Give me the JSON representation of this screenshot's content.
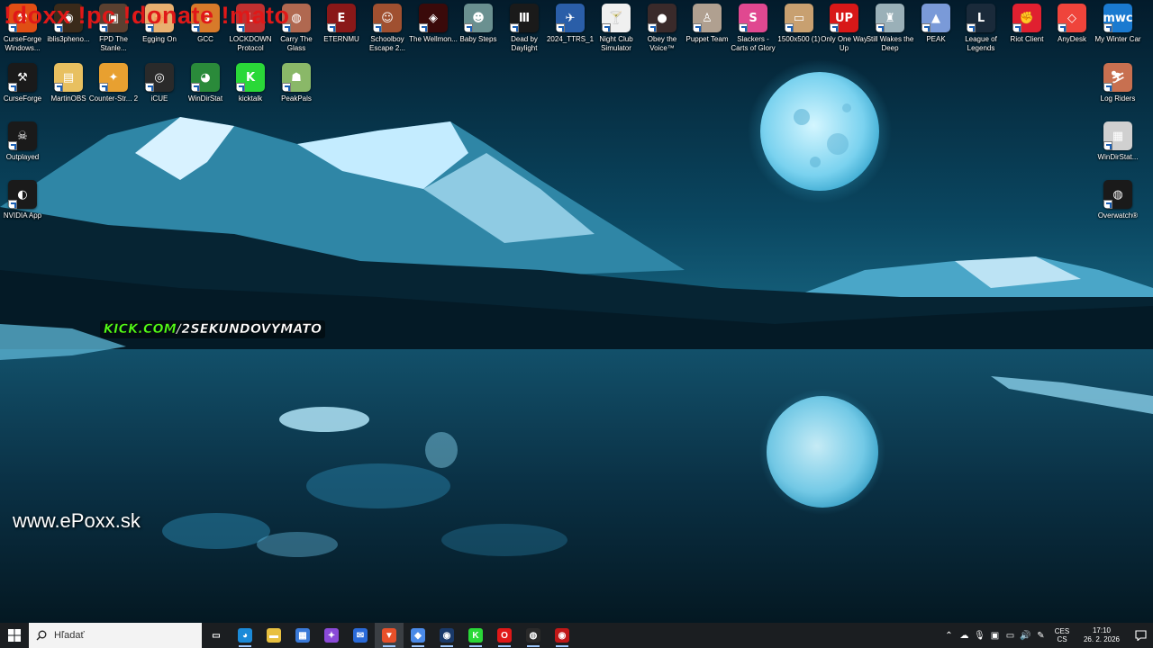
{
  "overlay": {
    "commands": "!doxx !pc !donate !mato",
    "kick_prefix": "KICK.COM",
    "kick_suffix": "/2SEKUNDOVYMATO",
    "site_url": "www.ePoxx.sk"
  },
  "desktop_icons": [
    {
      "name": "curseforge-windows",
      "label": "CurseForge Windows...",
      "color": "#e04e14",
      "glyph": "⚒"
    },
    {
      "name": "iblis3pheno",
      "label": "iblis3pheno...",
      "color": "#3a2a1a",
      "glyph": "◉"
    },
    {
      "name": "fpd-the-stanley",
      "label": "FPD The Stanle...",
      "color": "#5a4030",
      "glyph": "▣"
    },
    {
      "name": "egging-on",
      "label": "Egging On",
      "color": "#e8b070",
      "glyph": "🥚"
    },
    {
      "name": "gcc",
      "label": "GCC",
      "color": "#d87a2a",
      "glyph": "G"
    },
    {
      "name": "lockdown-protocol",
      "label": "LOCKDOWN Protocol",
      "color": "#c03030",
      "glyph": "L"
    },
    {
      "name": "carry-the-glass",
      "label": "Carry The Glass",
      "color": "#b06850",
      "glyph": "◍"
    },
    {
      "name": "eternmu",
      "label": "ETERNMU",
      "color": "#8a1818",
      "glyph": "E"
    },
    {
      "name": "schoolboy-escape",
      "label": "Schoolboy Escape 2...",
      "color": "#a05030",
      "glyph": "☺"
    },
    {
      "name": "the-wellmonster",
      "label": "The Wellmon...",
      "color": "#3a0a0a",
      "glyph": "◈"
    },
    {
      "name": "baby-steps",
      "label": "Baby Steps",
      "color": "#6a9090",
      "glyph": "☻"
    },
    {
      "name": "dead-by-daylight",
      "label": "Dead by Daylight",
      "color": "#1a1a1a",
      "glyph": "Ⅲ"
    },
    {
      "name": "2024-ttrs",
      "label": "2024_TTRS_1",
      "color": "#2a5ea8",
      "glyph": "✈"
    },
    {
      "name": "night-club-simulator",
      "label": "Night Club Simulator",
      "color": "#f0f0f0",
      "glyph": "🍸"
    },
    {
      "name": "obey-the-voice",
      "label": "Obey the Voice™",
      "color": "#3a2a2a",
      "glyph": "●"
    },
    {
      "name": "puppet-team",
      "label": "Puppet Team",
      "color": "#b0a090",
      "glyph": "♙"
    },
    {
      "name": "slackers-carts-of-glory",
      "label": "Slackers - Carts of Glory",
      "color": "#e04890",
      "glyph": "S"
    },
    {
      "name": "image-1500x500",
      "label": "1500x500 (1)",
      "color": "#c8a070",
      "glyph": "▭"
    },
    {
      "name": "only-one-way-up",
      "label": "Only One Way Up",
      "color": "#d81818",
      "glyph": "UP"
    },
    {
      "name": "still-wakes-the-deep",
      "label": "Still Wakes the Deep",
      "color": "#9ab0b8",
      "glyph": "♜"
    },
    {
      "name": "peak",
      "label": "PEAK",
      "color": "#7a9ad8",
      "glyph": "▲"
    },
    {
      "name": "league-of-legends",
      "label": "League of Legends",
      "color": "#1a2a3a",
      "glyph": "L"
    },
    {
      "name": "riot-client",
      "label": "Riot Client",
      "color": "#e02030",
      "glyph": "✊"
    },
    {
      "name": "anydesk",
      "label": "AnyDesk",
      "color": "#ef443b",
      "glyph": "◇"
    },
    {
      "name": "my-winter-car",
      "label": "My Winter Car",
      "color": "#1a7ad0",
      "glyph": "mwc"
    },
    {
      "name": "curseforge",
      "label": "CurseForge",
      "color": "#1a1a1a",
      "glyph": "⚒"
    },
    {
      "name": "martinobs",
      "label": "MartinOBS",
      "color": "#e8c060",
      "glyph": "▤"
    },
    {
      "name": "counter-strike-2",
      "label": "Counter-Str... 2",
      "color": "#e8a030",
      "glyph": "✦"
    },
    {
      "name": "icue",
      "label": "iCUE",
      "color": "#2a2a2a",
      "glyph": "◎"
    },
    {
      "name": "windirstat",
      "label": "WinDirStat",
      "color": "#2a8a3a",
      "glyph": "◕"
    },
    {
      "name": "kicktalk",
      "label": "kicktalk",
      "color": "#2ad838",
      "glyph": "K"
    },
    {
      "name": "peakpals",
      "label": "PeakPals",
      "color": "#8ab868",
      "glyph": "☗"
    },
    {
      "name": "outplayed",
      "label": "Outplayed",
      "color": "#1a1a1a",
      "glyph": "☠"
    },
    {
      "name": "nvidia-app",
      "label": "NVIDIA App",
      "color": "#1a1a1a",
      "glyph": "◐"
    },
    {
      "name": "log-riders",
      "label": "Log Riders",
      "color": "#c87050",
      "glyph": "⛷"
    },
    {
      "name": "windirstat-installer",
      "label": "WinDirStat...",
      "color": "#d0d0d0",
      "glyph": "▦"
    },
    {
      "name": "overwatch",
      "label": "Overwatch®",
      "color": "#1a1a1a",
      "glyph": "◍"
    }
  ],
  "taskbar": {
    "search_placeholder": "Hľadať",
    "apps": [
      {
        "name": "task-view",
        "glyph": "▭",
        "color": "transparent"
      },
      {
        "name": "edge",
        "glyph": "◕",
        "color": "#1b8ad8"
      },
      {
        "name": "file-explorer",
        "glyph": "▬",
        "color": "#e8c040"
      },
      {
        "name": "microsoft-store",
        "glyph": "▦",
        "color": "#3a7ad8"
      },
      {
        "name": "copilot",
        "glyph": "✦",
        "color": "#8a4ad8"
      },
      {
        "name": "mail",
        "glyph": "✉",
        "color": "#2a6ad8"
      },
      {
        "name": "brave",
        "glyph": "▼",
        "color": "#e8502a"
      },
      {
        "name": "app-blue",
        "glyph": "◆",
        "color": "#4a8ae8"
      },
      {
        "name": "steam",
        "glyph": "◉",
        "color": "#1a3a6a"
      },
      {
        "name": "kick",
        "glyph": "K",
        "color": "#2ad838"
      },
      {
        "name": "opera",
        "glyph": "O",
        "color": "#e01818"
      },
      {
        "name": "obs",
        "glyph": "◍",
        "color": "#2a2a2a"
      },
      {
        "name": "recorder",
        "glyph": "◉",
        "color": "#c01818"
      }
    ],
    "tray": {
      "language_top": "CES",
      "language_bottom": "CS",
      "time": "17:10",
      "date": "26. 2. 2026"
    }
  }
}
